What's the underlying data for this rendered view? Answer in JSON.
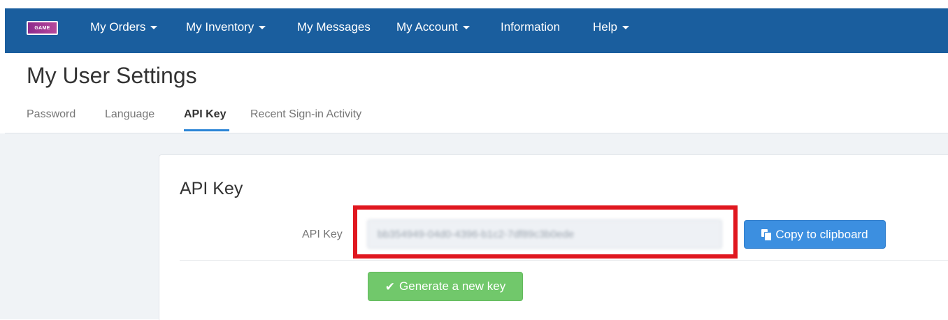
{
  "navbar": {
    "logo_text": "GAME",
    "items": [
      {
        "label": "My Orders",
        "dropdown": true
      },
      {
        "label": "My Inventory",
        "dropdown": true
      },
      {
        "label": "My Messages",
        "dropdown": false
      },
      {
        "label": "My Account",
        "dropdown": true
      },
      {
        "label": "Information",
        "dropdown": false
      },
      {
        "label": "Help",
        "dropdown": true
      }
    ],
    "background_color": "#1a5e9e"
  },
  "page": {
    "title": "My User Settings"
  },
  "tabs": [
    {
      "label": "Password",
      "active": false
    },
    {
      "label": "Language",
      "active": false
    },
    {
      "label": "API Key",
      "active": true
    },
    {
      "label": "Recent Sign-in Activity",
      "active": false
    }
  ],
  "panel": {
    "title": "API Key",
    "field_label": "API Key",
    "api_key_value": "bb354949-04d0-4396-b1c2-7df89c3b0ede",
    "copy_button_label": "Copy to clipboard",
    "generate_button_label": "Generate a new key"
  },
  "icons": {
    "copy": "copy-icon",
    "check": "check-icon",
    "caret": "caret-down-icon"
  },
  "colors": {
    "primary_button": "#3c8fe0",
    "success_button": "#71c86b",
    "highlight": "#e0171f",
    "active_tab_underline": "#2a84d6"
  }
}
